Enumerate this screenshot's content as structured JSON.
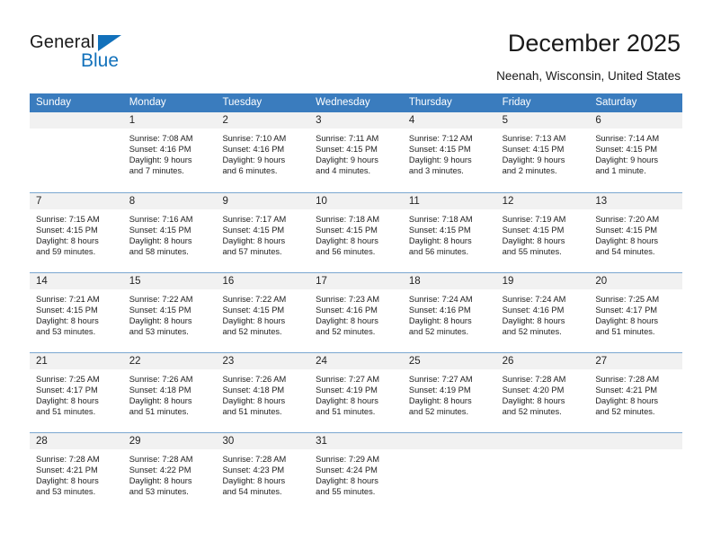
{
  "brand": {
    "name_line1": "General",
    "name_line2": "Blue",
    "accent_color": "#1271bb"
  },
  "header": {
    "title": "December 2025",
    "location": "Neenah, Wisconsin, United States"
  },
  "theme": {
    "header_row_bg": "#3a7cbe",
    "day_band_bg": "#f1f1f1",
    "grid_line": "#7ba7d0",
    "text": "#222222"
  },
  "weekdays": [
    "Sunday",
    "Monday",
    "Tuesday",
    "Wednesday",
    "Thursday",
    "Friday",
    "Saturday"
  ],
  "weeks": [
    [
      {
        "day": "",
        "sunrise": "",
        "sunset": "",
        "daylight_line1": "",
        "daylight_line2": ""
      },
      {
        "day": "1",
        "sunrise": "Sunrise: 7:08 AM",
        "sunset": "Sunset: 4:16 PM",
        "daylight_line1": "Daylight: 9 hours",
        "daylight_line2": "and 7 minutes."
      },
      {
        "day": "2",
        "sunrise": "Sunrise: 7:10 AM",
        "sunset": "Sunset: 4:16 PM",
        "daylight_line1": "Daylight: 9 hours",
        "daylight_line2": "and 6 minutes."
      },
      {
        "day": "3",
        "sunrise": "Sunrise: 7:11 AM",
        "sunset": "Sunset: 4:15 PM",
        "daylight_line1": "Daylight: 9 hours",
        "daylight_line2": "and 4 minutes."
      },
      {
        "day": "4",
        "sunrise": "Sunrise: 7:12 AM",
        "sunset": "Sunset: 4:15 PM",
        "daylight_line1": "Daylight: 9 hours",
        "daylight_line2": "and 3 minutes."
      },
      {
        "day": "5",
        "sunrise": "Sunrise: 7:13 AM",
        "sunset": "Sunset: 4:15 PM",
        "daylight_line1": "Daylight: 9 hours",
        "daylight_line2": "and 2 minutes."
      },
      {
        "day": "6",
        "sunrise": "Sunrise: 7:14 AM",
        "sunset": "Sunset: 4:15 PM",
        "daylight_line1": "Daylight: 9 hours",
        "daylight_line2": "and 1 minute."
      }
    ],
    [
      {
        "day": "7",
        "sunrise": "Sunrise: 7:15 AM",
        "sunset": "Sunset: 4:15 PM",
        "daylight_line1": "Daylight: 8 hours",
        "daylight_line2": "and 59 minutes."
      },
      {
        "day": "8",
        "sunrise": "Sunrise: 7:16 AM",
        "sunset": "Sunset: 4:15 PM",
        "daylight_line1": "Daylight: 8 hours",
        "daylight_line2": "and 58 minutes."
      },
      {
        "day": "9",
        "sunrise": "Sunrise: 7:17 AM",
        "sunset": "Sunset: 4:15 PM",
        "daylight_line1": "Daylight: 8 hours",
        "daylight_line2": "and 57 minutes."
      },
      {
        "day": "10",
        "sunrise": "Sunrise: 7:18 AM",
        "sunset": "Sunset: 4:15 PM",
        "daylight_line1": "Daylight: 8 hours",
        "daylight_line2": "and 56 minutes."
      },
      {
        "day": "11",
        "sunrise": "Sunrise: 7:18 AM",
        "sunset": "Sunset: 4:15 PM",
        "daylight_line1": "Daylight: 8 hours",
        "daylight_line2": "and 56 minutes."
      },
      {
        "day": "12",
        "sunrise": "Sunrise: 7:19 AM",
        "sunset": "Sunset: 4:15 PM",
        "daylight_line1": "Daylight: 8 hours",
        "daylight_line2": "and 55 minutes."
      },
      {
        "day": "13",
        "sunrise": "Sunrise: 7:20 AM",
        "sunset": "Sunset: 4:15 PM",
        "daylight_line1": "Daylight: 8 hours",
        "daylight_line2": "and 54 minutes."
      }
    ],
    [
      {
        "day": "14",
        "sunrise": "Sunrise: 7:21 AM",
        "sunset": "Sunset: 4:15 PM",
        "daylight_line1": "Daylight: 8 hours",
        "daylight_line2": "and 53 minutes."
      },
      {
        "day": "15",
        "sunrise": "Sunrise: 7:22 AM",
        "sunset": "Sunset: 4:15 PM",
        "daylight_line1": "Daylight: 8 hours",
        "daylight_line2": "and 53 minutes."
      },
      {
        "day": "16",
        "sunrise": "Sunrise: 7:22 AM",
        "sunset": "Sunset: 4:15 PM",
        "daylight_line1": "Daylight: 8 hours",
        "daylight_line2": "and 52 minutes."
      },
      {
        "day": "17",
        "sunrise": "Sunrise: 7:23 AM",
        "sunset": "Sunset: 4:16 PM",
        "daylight_line1": "Daylight: 8 hours",
        "daylight_line2": "and 52 minutes."
      },
      {
        "day": "18",
        "sunrise": "Sunrise: 7:24 AM",
        "sunset": "Sunset: 4:16 PM",
        "daylight_line1": "Daylight: 8 hours",
        "daylight_line2": "and 52 minutes."
      },
      {
        "day": "19",
        "sunrise": "Sunrise: 7:24 AM",
        "sunset": "Sunset: 4:16 PM",
        "daylight_line1": "Daylight: 8 hours",
        "daylight_line2": "and 52 minutes."
      },
      {
        "day": "20",
        "sunrise": "Sunrise: 7:25 AM",
        "sunset": "Sunset: 4:17 PM",
        "daylight_line1": "Daylight: 8 hours",
        "daylight_line2": "and 51 minutes."
      }
    ],
    [
      {
        "day": "21",
        "sunrise": "Sunrise: 7:25 AM",
        "sunset": "Sunset: 4:17 PM",
        "daylight_line1": "Daylight: 8 hours",
        "daylight_line2": "and 51 minutes."
      },
      {
        "day": "22",
        "sunrise": "Sunrise: 7:26 AM",
        "sunset": "Sunset: 4:18 PM",
        "daylight_line1": "Daylight: 8 hours",
        "daylight_line2": "and 51 minutes."
      },
      {
        "day": "23",
        "sunrise": "Sunrise: 7:26 AM",
        "sunset": "Sunset: 4:18 PM",
        "daylight_line1": "Daylight: 8 hours",
        "daylight_line2": "and 51 minutes."
      },
      {
        "day": "24",
        "sunrise": "Sunrise: 7:27 AM",
        "sunset": "Sunset: 4:19 PM",
        "daylight_line1": "Daylight: 8 hours",
        "daylight_line2": "and 51 minutes."
      },
      {
        "day": "25",
        "sunrise": "Sunrise: 7:27 AM",
        "sunset": "Sunset: 4:19 PM",
        "daylight_line1": "Daylight: 8 hours",
        "daylight_line2": "and 52 minutes."
      },
      {
        "day": "26",
        "sunrise": "Sunrise: 7:28 AM",
        "sunset": "Sunset: 4:20 PM",
        "daylight_line1": "Daylight: 8 hours",
        "daylight_line2": "and 52 minutes."
      },
      {
        "day": "27",
        "sunrise": "Sunrise: 7:28 AM",
        "sunset": "Sunset: 4:21 PM",
        "daylight_line1": "Daylight: 8 hours",
        "daylight_line2": "and 52 minutes."
      }
    ],
    [
      {
        "day": "28",
        "sunrise": "Sunrise: 7:28 AM",
        "sunset": "Sunset: 4:21 PM",
        "daylight_line1": "Daylight: 8 hours",
        "daylight_line2": "and 53 minutes."
      },
      {
        "day": "29",
        "sunrise": "Sunrise: 7:28 AM",
        "sunset": "Sunset: 4:22 PM",
        "daylight_line1": "Daylight: 8 hours",
        "daylight_line2": "and 53 minutes."
      },
      {
        "day": "30",
        "sunrise": "Sunrise: 7:28 AM",
        "sunset": "Sunset: 4:23 PM",
        "daylight_line1": "Daylight: 8 hours",
        "daylight_line2": "and 54 minutes."
      },
      {
        "day": "31",
        "sunrise": "Sunrise: 7:29 AM",
        "sunset": "Sunset: 4:24 PM",
        "daylight_line1": "Daylight: 8 hours",
        "daylight_line2": "and 55 minutes."
      },
      {
        "day": "",
        "sunrise": "",
        "sunset": "",
        "daylight_line1": "",
        "daylight_line2": ""
      },
      {
        "day": "",
        "sunrise": "",
        "sunset": "",
        "daylight_line1": "",
        "daylight_line2": ""
      },
      {
        "day": "",
        "sunrise": "",
        "sunset": "",
        "daylight_line1": "",
        "daylight_line2": ""
      }
    ]
  ]
}
